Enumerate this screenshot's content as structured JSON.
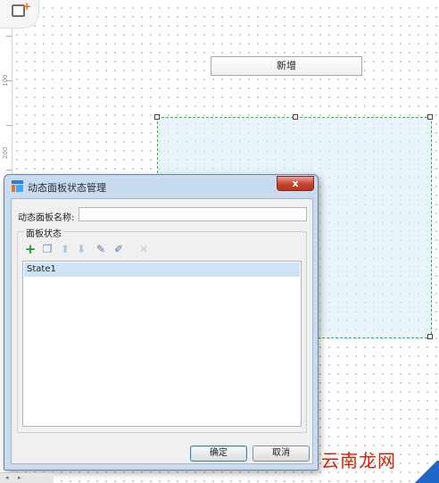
{
  "ruler": {
    "labels": [
      "100",
      "200"
    ]
  },
  "canvas": {
    "button_label": "新增"
  },
  "dialog": {
    "title": "动态面板状态管理",
    "close_symbol": "x",
    "name_label": "动态面板名称:",
    "name_value": "",
    "group_title": "面板状态",
    "toolbar_icons": [
      "add-icon",
      "copy-icon",
      "move-up-icon",
      "move-down-icon",
      "edit-state-icon",
      "edit-all-icon",
      "delete-icon"
    ],
    "states": [
      "State1"
    ],
    "ok_label": "确定",
    "cancel_label": "取消"
  },
  "watermark": "云南龙网",
  "colors": {
    "panel_border": "#28c22c",
    "panel_fill": "#dcecf8",
    "selected_row": "#cfe3f7",
    "dialog_frame": "#c9dbee",
    "close_button": "#c8422f",
    "watermark": "#d81e06"
  }
}
